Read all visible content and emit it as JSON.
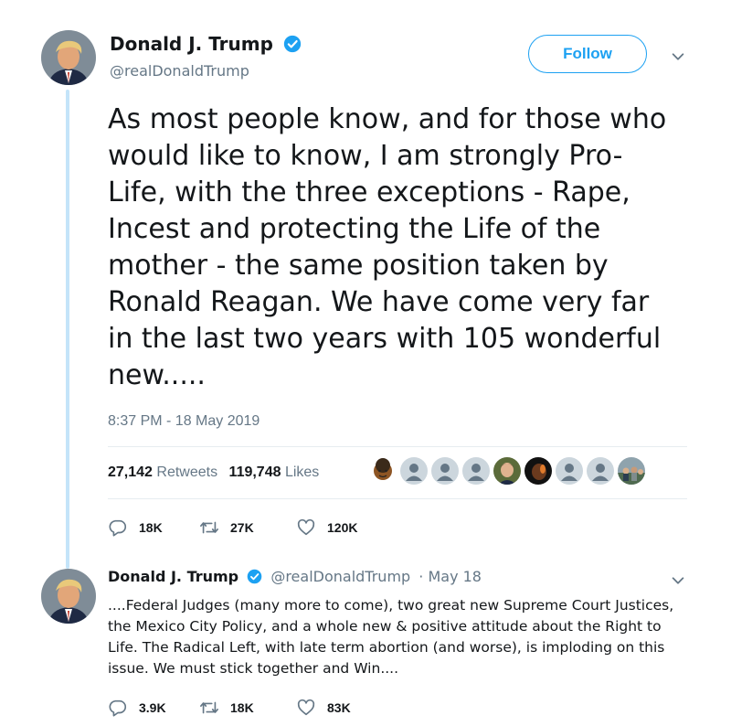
{
  "tweet": {
    "author_name": "Donald J. Trump",
    "author_handle": "@realDonaldTrump",
    "follow_label": "Follow",
    "text": "As most people know, and for those who\nwould like to know, I am strongly Pro-\nLife, with the three exceptions - Rape,\nIncest and protecting the Life of the\nmother - the same position taken by\nRonald Reagan. We have come very far\nin the last two years with 105 wonderful\nnew.....",
    "timestamp": "8:37 PM - 18 May 2019",
    "retweets_count": "27,142",
    "retweets_label": "Retweets",
    "likes_count": "119,748",
    "likes_label": "Likes",
    "actions": {
      "replies": "18K",
      "retweets": "27K",
      "likes": "120K"
    }
  },
  "reply_tweet": {
    "author_name": "Donald J. Trump",
    "author_handle": "@realDonaldTrump",
    "date": "· May 18",
    "text": "....Federal Judges (many more to come), two great new Supreme Court Justices,\nthe Mexico City Policy, and a whole new & positive attitude about the Right to\nLife. The Radical Left, with late term abortion (and worse), is imploding on this\nissue. We must stick together and Win....",
    "actions": {
      "replies": "3.9K",
      "retweets": "18K",
      "likes": "83K"
    }
  },
  "icons": {
    "verified": "verified-badge-icon",
    "caret": "chevron-down-icon",
    "reply": "reply-icon",
    "retweet": "retweet-icon",
    "like": "heart-icon"
  },
  "colors": {
    "accent": "#1da1f2",
    "text": "#14171a",
    "muted": "#657786",
    "thread_line": "#c4e4f9",
    "divider": "#e6ecf0"
  }
}
